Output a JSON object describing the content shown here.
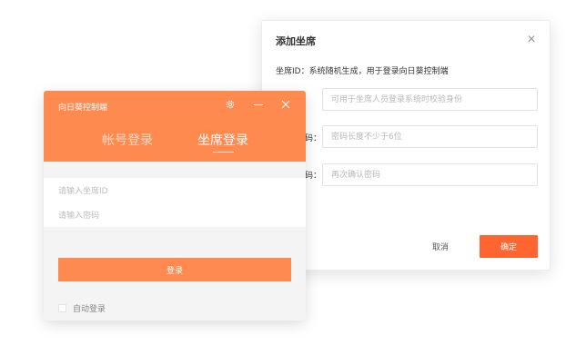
{
  "seat_dialog": {
    "title": "添加坐席",
    "close_icon": "close-icon",
    "description": "坐席ID：系统随机生成，用于登录向日葵控制端",
    "rows": [
      {
        "label": "",
        "placeholder": "可用于坐席人员登录系统时校验身份",
        "value": ""
      },
      {
        "label": "码：",
        "placeholder": "密码长度不少于6位",
        "value": ""
      },
      {
        "label": "码：",
        "placeholder": "再次确认密码",
        "value": ""
      }
    ],
    "cancel_label": "取消",
    "ok_label": "确定"
  },
  "login_window": {
    "title": "向日葵控制端",
    "icons": {
      "settings": "gear-icon",
      "minimize": "minimize-icon",
      "close": "close-icon"
    },
    "tabs": {
      "account": "帐号登录",
      "seat": "坐席登录"
    },
    "active_tab": "seat",
    "seat_id_placeholder": "请输入坐席ID",
    "password_placeholder": "请输入密码",
    "login_label": "登录",
    "auto_login_label": "自动登录",
    "auto_login_checked": false
  },
  "colors": {
    "accent_light": "#ff8a50",
    "accent_strong": "#ff6530"
  }
}
